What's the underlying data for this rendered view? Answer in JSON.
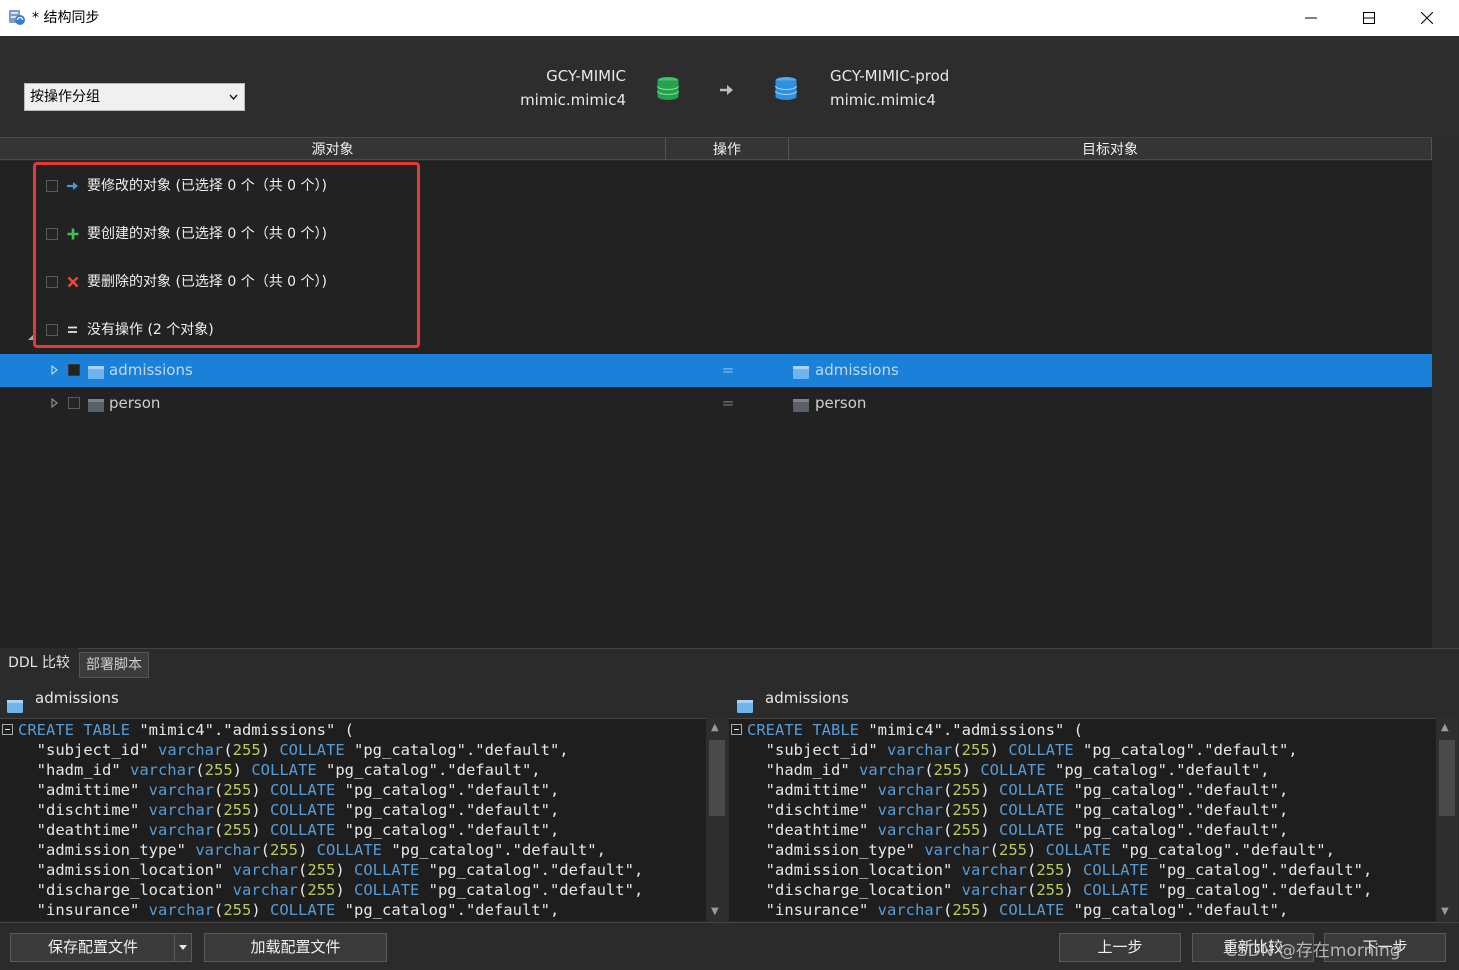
{
  "window": {
    "title": "* 结构同步",
    "minimize_icon": "minimize-icon",
    "maximize_icon": "maximize-icon",
    "close_icon": "close-icon"
  },
  "toolbar": {
    "group_select_value": "按操作分组"
  },
  "connection": {
    "source_name": "GCY-MIMIC",
    "source_schema": "mimic.mimic4",
    "target_name": "GCY-MIMIC-prod",
    "target_schema": "mimic.mimic4",
    "source_color": "#2ea44f",
    "target_color": "#2f8fe0"
  },
  "columns": {
    "source": "源对象",
    "operation": "操作",
    "target": "目标对象"
  },
  "groups": {
    "modify": "要修改的对象 (已选择 0 个（共 0 个）)",
    "create": "要创建的对象 (已选择 0 个（共 0 个）)",
    "delete": "要删除的对象 (已选择 0 个（共 0 个）)",
    "noop": "没有操作 (2 个对象)"
  },
  "rows": [
    {
      "source": "admissions",
      "op": "=",
      "target": "admissions",
      "selected": true
    },
    {
      "source": "person",
      "op": "=",
      "target": "person",
      "selected": false
    }
  ],
  "tabs": {
    "ddl": "DDL 比较",
    "deploy": "部署脚本"
  },
  "ddl": {
    "left_title": "admissions",
    "right_title": "admissions",
    "lines": [
      [
        "CREATE TABLE",
        " \"mimic4\".\"admissions\" ("
      ],
      [
        "subject_id",
        "255"
      ],
      [
        "hadm_id",
        "255"
      ],
      [
        "admittime",
        "255"
      ],
      [
        "dischtime",
        "255"
      ],
      [
        "deathtime",
        "255"
      ],
      [
        "admission_type",
        "255"
      ],
      [
        "admission_location",
        "255"
      ],
      [
        "discharge_location",
        "255"
      ],
      [
        "insurance",
        "255"
      ]
    ],
    "kw_varchar": "varchar",
    "kw_collate": "COLLATE",
    "collation": " \"pg_catalog\".\"default\","
  },
  "footer": {
    "save": "保存配置文件",
    "load": "加载配置文件",
    "prev": "上一步",
    "compare": "重新比较",
    "next": "下一步",
    "watermark": "CSDN @存在morning"
  }
}
